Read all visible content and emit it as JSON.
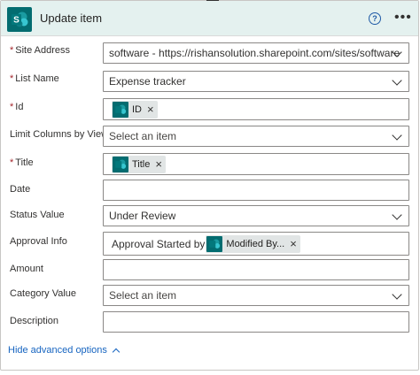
{
  "action": {
    "title": "Update item",
    "icon": "sharepoint-icon",
    "help_label": "?",
    "more_label": "•••"
  },
  "required_mark": "*",
  "fields": {
    "site_address": {
      "label": "Site Address",
      "value": "software - https://rishansolution.sharepoint.com/sites/software"
    },
    "list_name": {
      "label": "List Name",
      "value": "Expense tracker"
    },
    "id": {
      "label": "Id",
      "token": "ID"
    },
    "limit_columns": {
      "label": "Limit Columns by View",
      "placeholder": "Select an item"
    },
    "title": {
      "label": "Title",
      "token": "Title"
    },
    "date": {
      "label": "Date",
      "value": ""
    },
    "status_value": {
      "label": "Status Value",
      "value": "Under Review"
    },
    "approval_info": {
      "label": "Approval Info",
      "prefix_text": "Approval Started by",
      "token": "Modified By..."
    },
    "amount": {
      "label": "Amount",
      "value": ""
    },
    "category_value": {
      "label": "Category Value",
      "placeholder": "Select an item"
    },
    "description": {
      "label": "Description",
      "value": ""
    }
  },
  "footer": {
    "hide_advanced_label": "Hide advanced options"
  },
  "colors": {
    "header_bg": "#e4f1ef",
    "sharepoint_teal": "#036c70",
    "link_blue": "#1664c0",
    "required_red": "#a4262c"
  }
}
